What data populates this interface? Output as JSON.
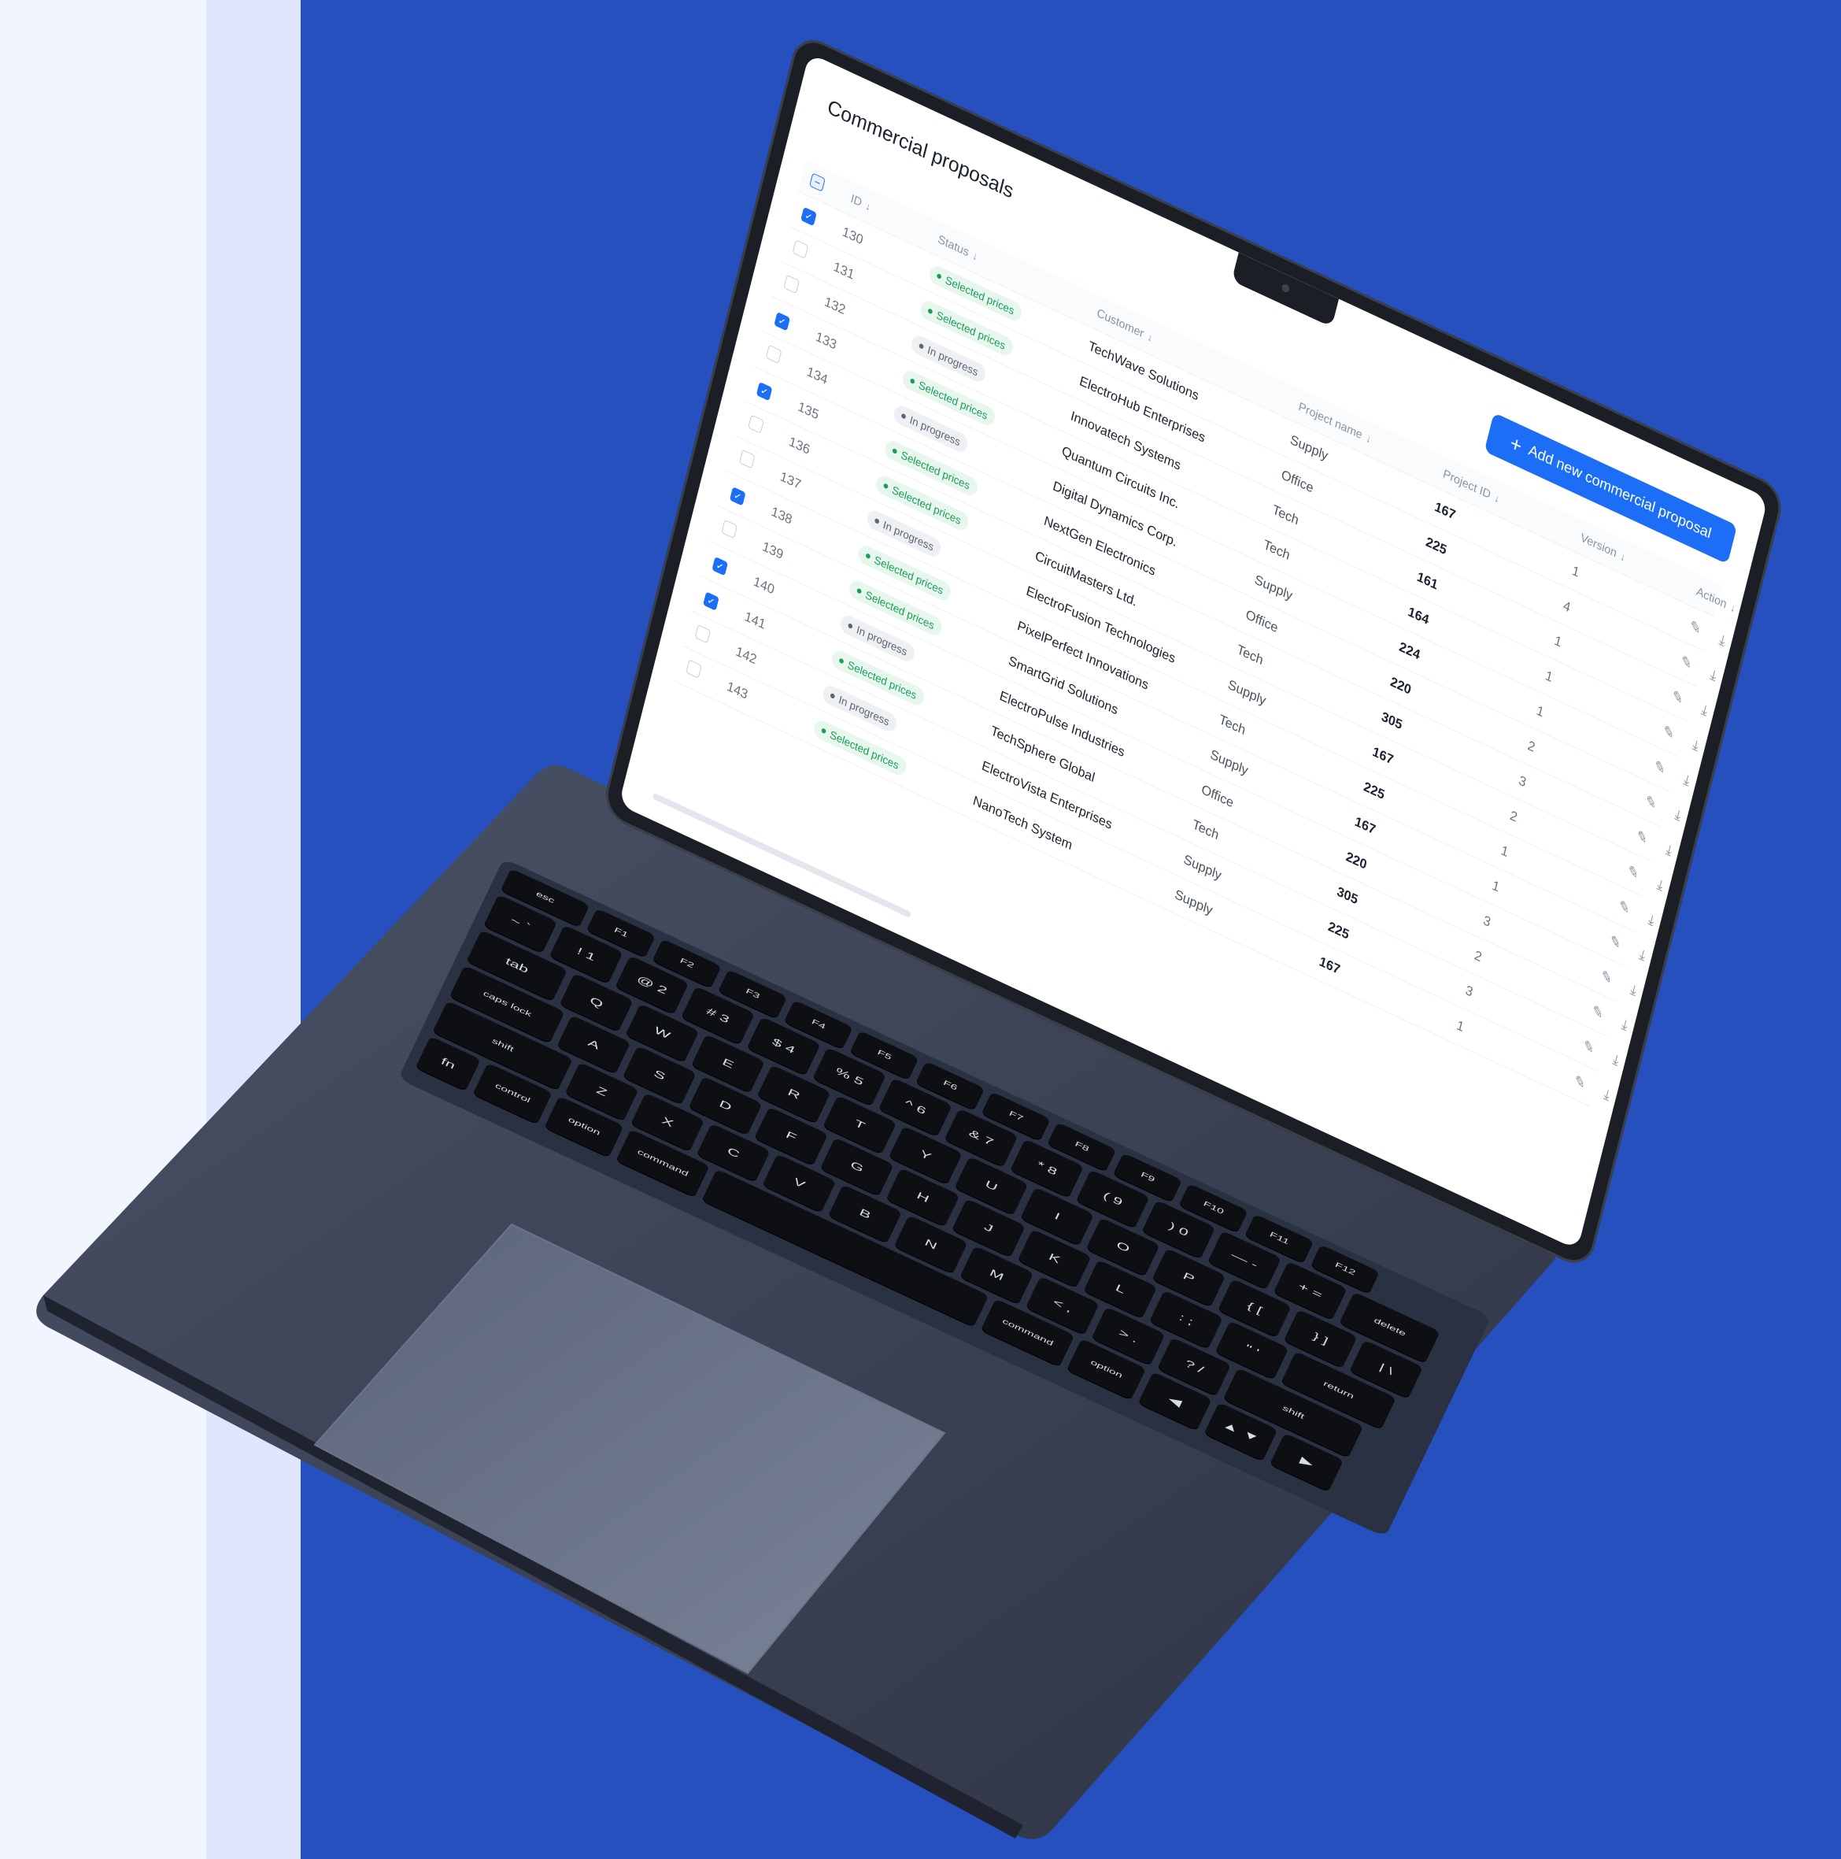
{
  "colors": {
    "background_left": "#f2f5ff",
    "background_strip": "#dfe5fb",
    "background_blue": "#2550bd",
    "laptop_body": "#3d4456",
    "accent": "#1b6ef5",
    "status_green": "#1a9e57"
  },
  "page": {
    "title": "Commercial proposals",
    "add_button_label": "Add new commercial proposal",
    "add_button_icon": "plus-icon"
  },
  "table": {
    "headers": {
      "id": "ID",
      "status": "Status",
      "customer": "Customer",
      "project_name": "Project name",
      "project_id": "Project ID",
      "version": "Version",
      "action": "Action"
    },
    "rows": [
      {
        "id": "130",
        "checked": true,
        "status": "Selected prices",
        "status_type": "green",
        "customer": "TechWave Solutions",
        "project_name": "Supply",
        "project_id": "167",
        "version": "1"
      },
      {
        "id": "131",
        "checked": false,
        "status": "Selected prices",
        "status_type": "green",
        "customer": "ElectroHub Enterprises",
        "project_name": "Office",
        "project_id": "225",
        "version": "4"
      },
      {
        "id": "132",
        "checked": false,
        "status": "In progress",
        "status_type": "gray",
        "customer": "Innovatech Systems",
        "project_name": "Tech",
        "project_id": "161",
        "version": "1"
      },
      {
        "id": "133",
        "checked": true,
        "status": "Selected prices",
        "status_type": "green",
        "customer": "Quantum Circuits Inc.",
        "project_name": "Tech",
        "project_id": "164",
        "version": "1"
      },
      {
        "id": "134",
        "checked": false,
        "status": "In progress",
        "status_type": "gray",
        "customer": "Digital Dynamics Corp.",
        "project_name": "Supply",
        "project_id": "224",
        "version": "1"
      },
      {
        "id": "135",
        "checked": true,
        "status": "Selected prices",
        "status_type": "green",
        "customer": "NextGen Electronics",
        "project_name": "Office",
        "project_id": "220",
        "version": "2"
      },
      {
        "id": "136",
        "checked": false,
        "status": "Selected prices",
        "status_type": "green",
        "customer": "CircuitMasters Ltd.",
        "project_name": "Tech",
        "project_id": "305",
        "version": "3"
      },
      {
        "id": "137",
        "checked": false,
        "status": "In progress",
        "status_type": "gray",
        "customer": "ElectroFusion Technologies",
        "project_name": "Supply",
        "project_id": "167",
        "version": "2"
      },
      {
        "id": "138",
        "checked": true,
        "status": "Selected prices",
        "status_type": "green",
        "customer": "PixelPerfect Innovations",
        "project_name": "Tech",
        "project_id": "225",
        "version": "1"
      },
      {
        "id": "139",
        "checked": false,
        "status": "Selected prices",
        "status_type": "green",
        "customer": "SmartGrid Solutions",
        "project_name": "Supply",
        "project_id": "167",
        "version": "1"
      },
      {
        "id": "140",
        "checked": true,
        "status": "In progress",
        "status_type": "gray",
        "customer": "ElectroPulse Industries",
        "project_name": "Office",
        "project_id": "220",
        "version": "3"
      },
      {
        "id": "141",
        "checked": true,
        "status": "Selected prices",
        "status_type": "green",
        "customer": "TechSphere Global",
        "project_name": "Tech",
        "project_id": "305",
        "version": "2"
      },
      {
        "id": "142",
        "checked": false,
        "status": "In progress",
        "status_type": "gray",
        "customer": "ElectroVista Enterprises",
        "project_name": "Supply",
        "project_id": "225",
        "version": "3"
      },
      {
        "id": "143",
        "checked": false,
        "status": "Selected prices",
        "status_type": "green",
        "customer": "NanoTech System",
        "project_name": "Supply",
        "project_id": "167",
        "version": "1"
      }
    ],
    "action_icons": [
      "pencil-icon",
      "download-icon",
      "folder-icon",
      "copy-icon"
    ]
  },
  "keyboard": {
    "row_fn": [
      "esc",
      "F1",
      "F2",
      "F3",
      "F4",
      "F5",
      "F6",
      "F7",
      "F8",
      "F9",
      "F10",
      "F11",
      "F12"
    ],
    "row_num": [
      "~ `",
      "! 1",
      "@ 2",
      "# 3",
      "$ 4",
      "% 5",
      "^ 6",
      "& 7",
      "* 8",
      "( 9",
      ") 0",
      "— -",
      "+ =",
      "delete"
    ],
    "row_top": [
      "tab",
      "Q",
      "W",
      "E",
      "R",
      "T",
      "Y",
      "U",
      "I",
      "O",
      "P",
      "{ [",
      "} ]",
      "| \\"
    ],
    "row_mid": [
      "caps lock",
      "A",
      "S",
      "D",
      "F",
      "G",
      "H",
      "J",
      "K",
      "L",
      ": ;",
      "\" '",
      "return"
    ],
    "row_low": [
      "shift",
      "Z",
      "X",
      "C",
      "V",
      "B",
      "N",
      "M",
      "< ,",
      "> .",
      "? /",
      "shift"
    ],
    "row_bot": [
      "fn",
      "control",
      "option",
      "command",
      "",
      "command",
      "option",
      "◀",
      "▲ ▼",
      "▶"
    ]
  }
}
